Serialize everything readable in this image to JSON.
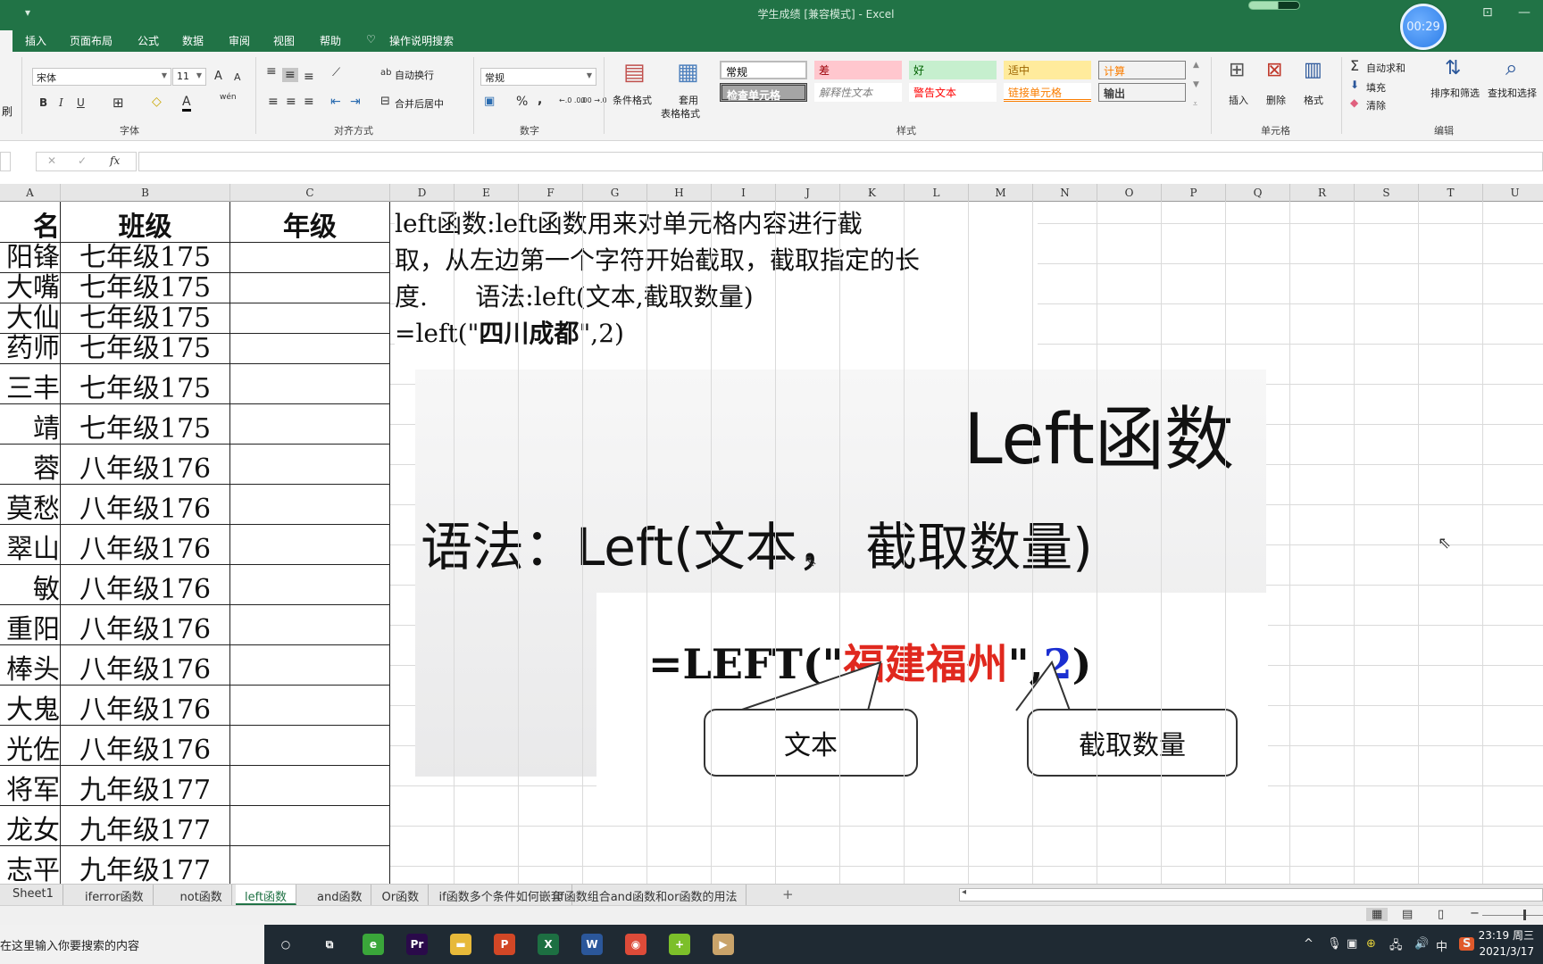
{
  "window": {
    "title": "学生成绩  [兼容模式]  -  Excel",
    "timer": "00:29",
    "quick_access_dropdown": "▾"
  },
  "ribbon_tabs": [
    "插入",
    "页面布局",
    "公式",
    "数据",
    "审阅",
    "视图",
    "帮助"
  ],
  "tell_me": "操作说明搜索",
  "ribbon": {
    "clipboard_partial_label": "刷",
    "font": {
      "name": "宋体",
      "size": "11",
      "group_label": "字体",
      "bold": "B",
      "italic": "I",
      "underline": "U",
      "grow": "A",
      "shrink": "A",
      "font_color": "A",
      "phonetic": "wén"
    },
    "alignment": {
      "wrap_text": "自动换行",
      "merge_center": "合并后居中",
      "group_label": "对齐方式"
    },
    "number": {
      "format": "常规",
      "percent": "%",
      "comma": ",",
      "inc_decimal": "←.0 .00",
      "dec_decimal": ".00 →.0",
      "group_label": "数字"
    },
    "styles": {
      "conditional_format": "条件格式",
      "format_as_table_1": "套用",
      "format_as_table_2": "表格格式",
      "group_label": "样式",
      "cells": [
        {
          "label": "常规",
          "bg": "#ffffff",
          "fg": "#000000"
        },
        {
          "label": "差",
          "bg": "#ffc7ce",
          "fg": "#9c0006"
        },
        {
          "label": "好",
          "bg": "#c6efce",
          "fg": "#006100"
        },
        {
          "label": "适中",
          "bg": "#ffeb9c",
          "fg": "#9c6500"
        },
        {
          "label": "计算",
          "bg": "#f2f2f2",
          "fg": "#fa7d00"
        },
        {
          "label": "检查单元格",
          "bg": "#a5a5a5",
          "fg": "#ffffff"
        },
        {
          "label": "解释性文本",
          "bg": "#ffffff",
          "fg": "#7f7f7f"
        },
        {
          "label": "警告文本",
          "bg": "#ffffff",
          "fg": "#ff0000"
        },
        {
          "label": "链接单元格",
          "bg": "#ffffff",
          "fg": "#fa7d00"
        },
        {
          "label": "输出",
          "bg": "#f2f2f2",
          "fg": "#3f3f3f"
        }
      ]
    },
    "cells": {
      "insert": "插入",
      "delete": "删除",
      "format": "格式",
      "group_label": "单元格"
    },
    "editing": {
      "autosum": "自动求和",
      "fill": "填充",
      "clear": "清除",
      "sort_filter": "排序和筛选",
      "find_select": "查找和选择",
      "group_label": "编辑"
    }
  },
  "formula_bar": {
    "cancel": "✕",
    "enter": "✓",
    "fx": "fx",
    "value": ""
  },
  "columns": [
    "A",
    "B",
    "C",
    "D",
    "E",
    "F",
    "G",
    "H",
    "I",
    "J",
    "K",
    "L",
    "M",
    "N",
    "O",
    "P",
    "Q",
    "R",
    "S",
    "T",
    "U"
  ],
  "table": {
    "headers": [
      "名",
      "班级",
      "年级"
    ],
    "rows": [
      [
        "阳锋",
        "七年级175",
        ""
      ],
      [
        "大嘴",
        "七年级175",
        ""
      ],
      [
        "大仙",
        "七年级175",
        ""
      ],
      [
        "药师",
        "七年级175",
        ""
      ],
      [
        "三丰",
        "七年级175",
        ""
      ],
      [
        "靖",
        "七年级175",
        ""
      ],
      [
        "蓉",
        "八年级176",
        ""
      ],
      [
        "莫愁",
        "八年级176",
        ""
      ],
      [
        "翠山",
        "八年级176",
        ""
      ],
      [
        "敏",
        "八年级176",
        ""
      ],
      [
        "重阳",
        "八年级176",
        ""
      ],
      [
        "棒头",
        "八年级176",
        ""
      ],
      [
        "大鬼",
        "八年级176",
        ""
      ],
      [
        "光佐",
        "八年级176",
        ""
      ],
      [
        "将军",
        "九年级177",
        ""
      ],
      [
        "龙女",
        "九年级177",
        ""
      ],
      [
        "志平",
        "九年级177",
        ""
      ]
    ]
  },
  "description": {
    "line1": "left函数:left函数用来对单元格内容进行截",
    "line2": "取，从左边第一个字符开始截取，截取指定的长",
    "line3": "度.      语法:left(文本,截取数量)",
    "line4_prefix": "=left(\"",
    "line4_bold": "四川成都",
    "line4_suffix": "\",2)"
  },
  "slide": {
    "title": "Left函数",
    "syntax": "语法：Left(文本， 截取数量)"
  },
  "example": {
    "prefix": "=LEFT(\"",
    "text_arg": "福建福州",
    "mid": "\",",
    "num_arg": "2",
    "suffix": ")",
    "callout_text": "文本",
    "callout_count": "截取数量",
    "text_color": "#e0281e",
    "num_color": "#1b2fd1"
  },
  "sheet_tabs": [
    {
      "label": "Sheet1",
      "active": false
    },
    {
      "label": "iferror函数",
      "active": false
    },
    {
      "label": "not函数",
      "active": false
    },
    {
      "label": "left函数",
      "active": true
    },
    {
      "label": "and函数",
      "active": false
    },
    {
      "label": "Or函数",
      "active": false
    },
    {
      "label": "if函数多个条件如何嵌套",
      "active": false
    },
    {
      "label": "if函数组合and函数和or函数的用法",
      "active": false
    }
  ],
  "add_sheet": "+",
  "taskbar": {
    "search_placeholder": "在这里输入你要搜索的内容",
    "apps": [
      {
        "name": "cortana",
        "glyph": "○",
        "color": "transparent"
      },
      {
        "name": "task-view",
        "glyph": "⧉",
        "color": "transparent"
      },
      {
        "name": "browser-360",
        "glyph": "e",
        "color": "#3aa63a"
      },
      {
        "name": "premiere",
        "glyph": "Pr",
        "color": "#2a0a4a"
      },
      {
        "name": "file-explorer",
        "glyph": "▬",
        "color": "#e7b93a"
      },
      {
        "name": "powerpoint",
        "glyph": "P",
        "color": "#d24726"
      },
      {
        "name": "excel",
        "glyph": "X",
        "color": "#1d6f42"
      },
      {
        "name": "word",
        "glyph": "W",
        "color": "#2b579a"
      },
      {
        "name": "chrome",
        "glyph": "◉",
        "color": "#dd4b39"
      },
      {
        "name": "app-green-plus",
        "glyph": "+",
        "color": "#7cbf2a"
      },
      {
        "name": "media-player",
        "glyph": "▶",
        "color": "#c9a36a"
      }
    ],
    "tray": {
      "chevron": "^",
      "ime": "中",
      "time": "23:19 周三",
      "date": "2021/3/17"
    }
  }
}
